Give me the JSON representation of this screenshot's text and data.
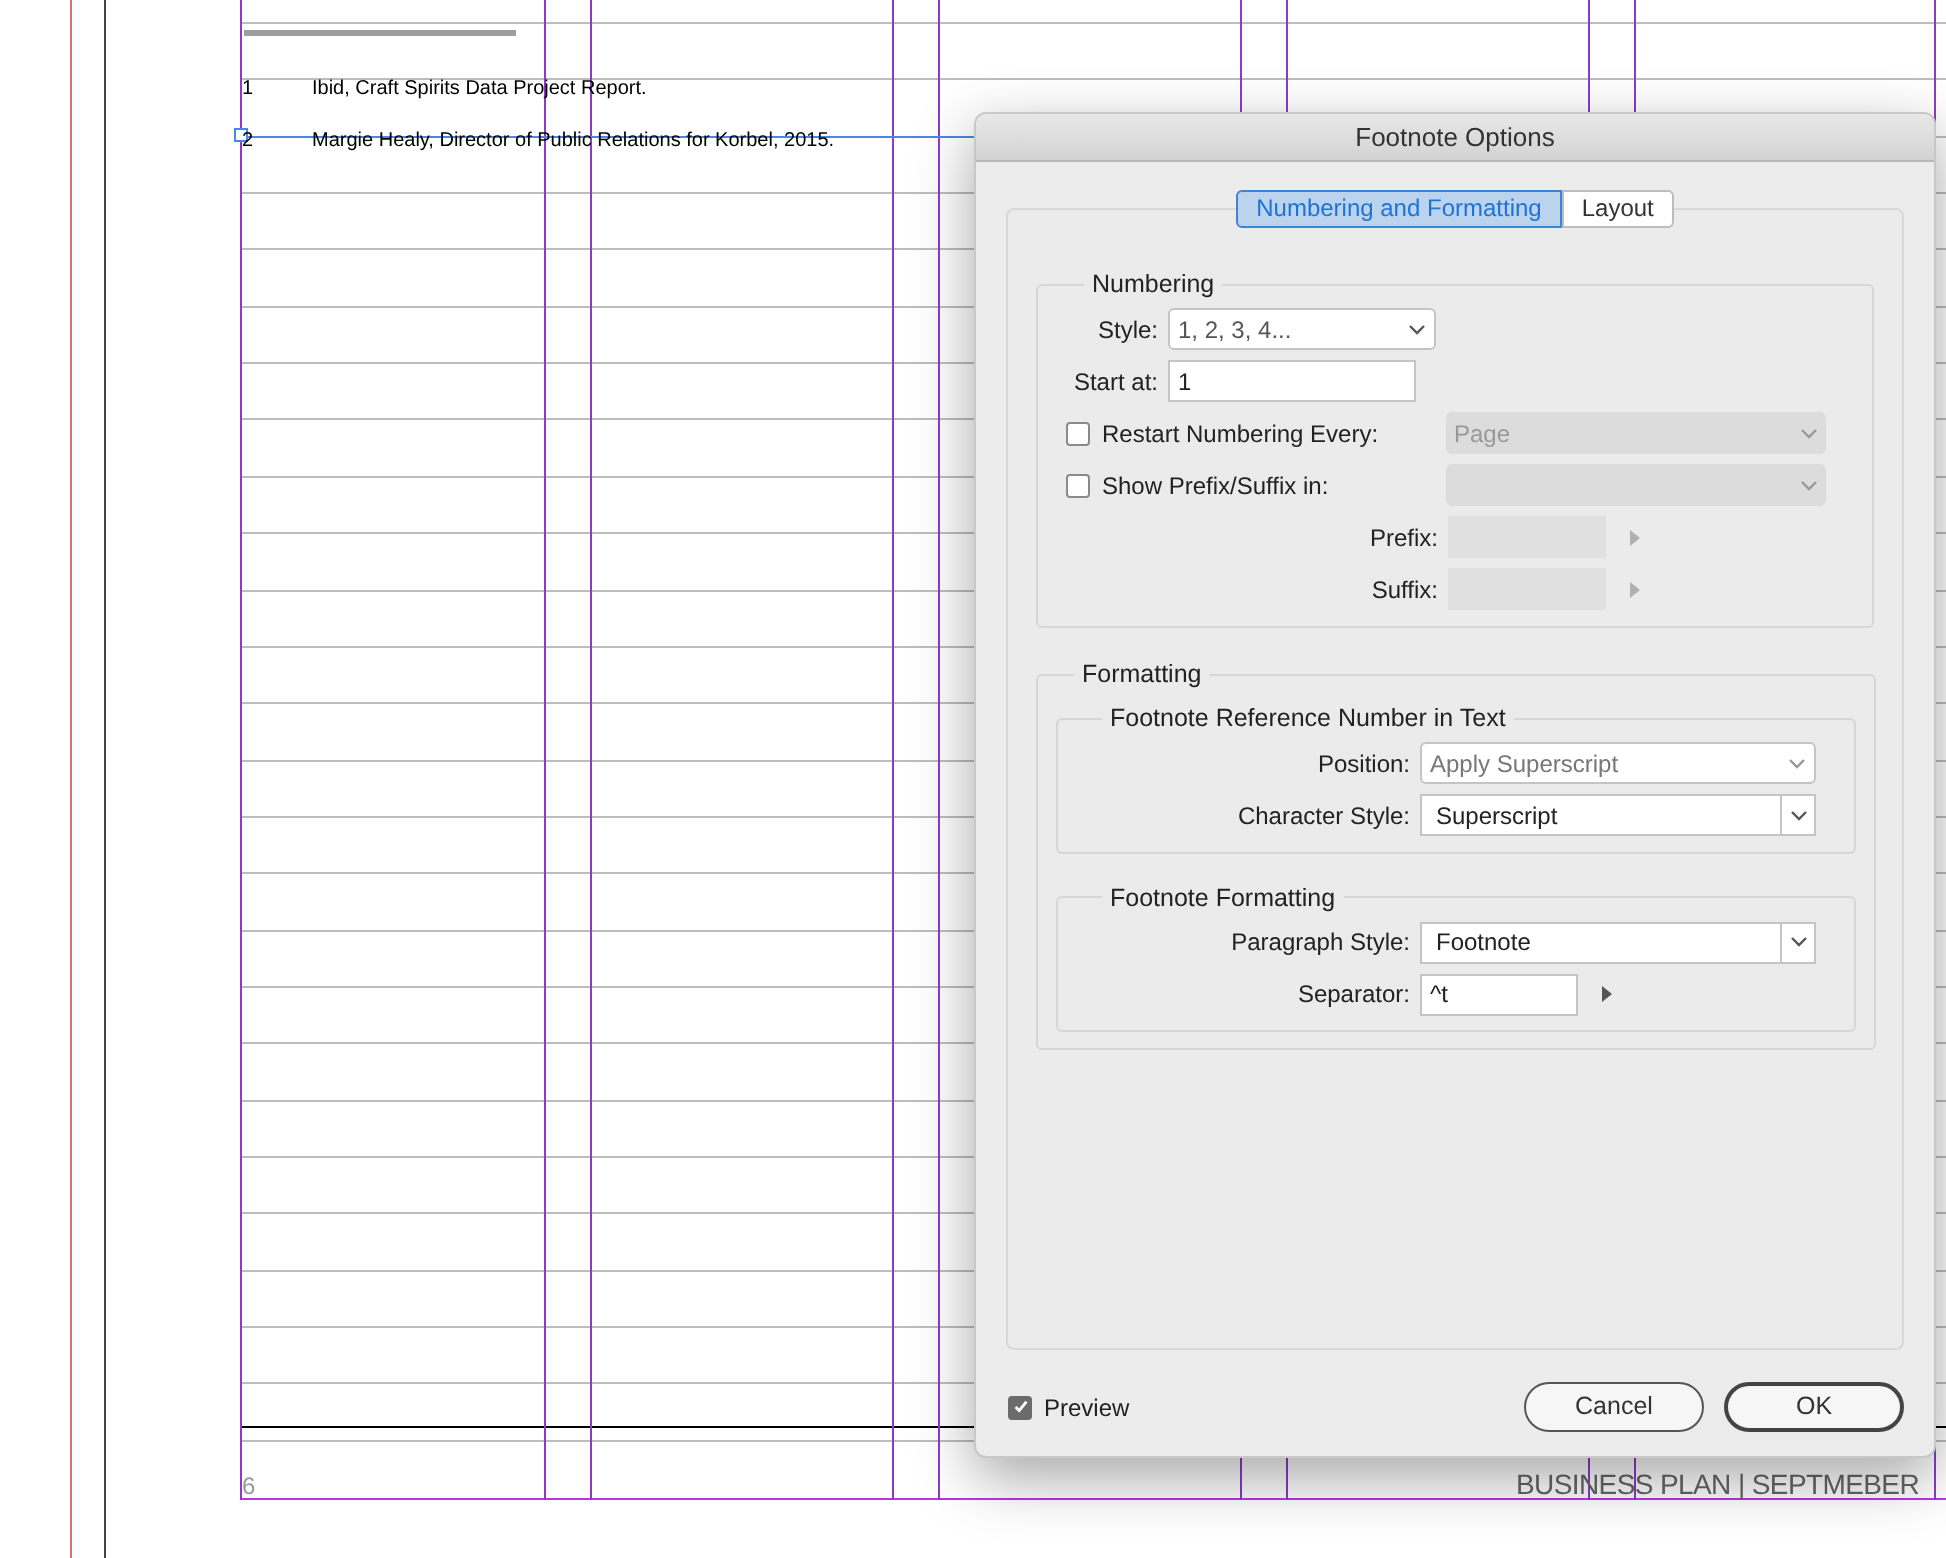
{
  "document": {
    "footnotes": [
      {
        "number": "1",
        "text": "Ibid, Craft Spirits Data Project Report."
      },
      {
        "number": "2",
        "text": "Margie Healy, Director of Public Relations for Korbel, 2015."
      }
    ],
    "page_number": "6",
    "footer": "BUSINESS PLAN | SEPTMEBER"
  },
  "dialog": {
    "title": "Footnote Options",
    "tabs": [
      {
        "label": "Numbering and Formatting",
        "selected": true
      },
      {
        "label": "Layout",
        "selected": false
      }
    ],
    "sections": [
      {
        "title": "Numbering",
        "rows": [
          {
            "kind": "select",
            "label": "Style:",
            "value": "1, 2, 3, 4...",
            "disabled": false
          },
          {
            "kind": "input",
            "label": "Start at:",
            "value": "1"
          },
          {
            "kind": "checkbox_select",
            "label": "Restart Numbering Every:",
            "checked": false,
            "value": "Page"
          },
          {
            "kind": "checkbox_select",
            "label": "Show Prefix/Suffix in:",
            "checked": false
          },
          {
            "kind": "input_arrow",
            "label": "Prefix:",
            "disabled": true
          },
          {
            "kind": "input_arrow",
            "label": "Suffix:",
            "disabled": true
          }
        ]
      },
      {
        "title": "Formatting",
        "groups": [
          {
            "title": "Footnote Reference Number in Text",
            "rows": [
              {
                "kind": "select",
                "label": "Position:",
                "value": "Apply Superscript",
                "disabled": true
              },
              {
                "kind": "combo",
                "label": "Character Style:",
                "value": "Superscript"
              }
            ]
          },
          {
            "title": "Footnote Formatting",
            "rows": [
              {
                "kind": "combo",
                "label": "Paragraph Style:",
                "value": "Footnote"
              },
              {
                "kind": "input_arrow",
                "label": "Separator:",
                "value": "^t",
                "disabled": false
              }
            ]
          }
        ]
      }
    ],
    "preview": {
      "label": "Preview",
      "checked": true
    },
    "buttons": [
      {
        "label": "Cancel",
        "kind": "secondary"
      },
      {
        "label": "OK",
        "kind": "default"
      }
    ]
  }
}
